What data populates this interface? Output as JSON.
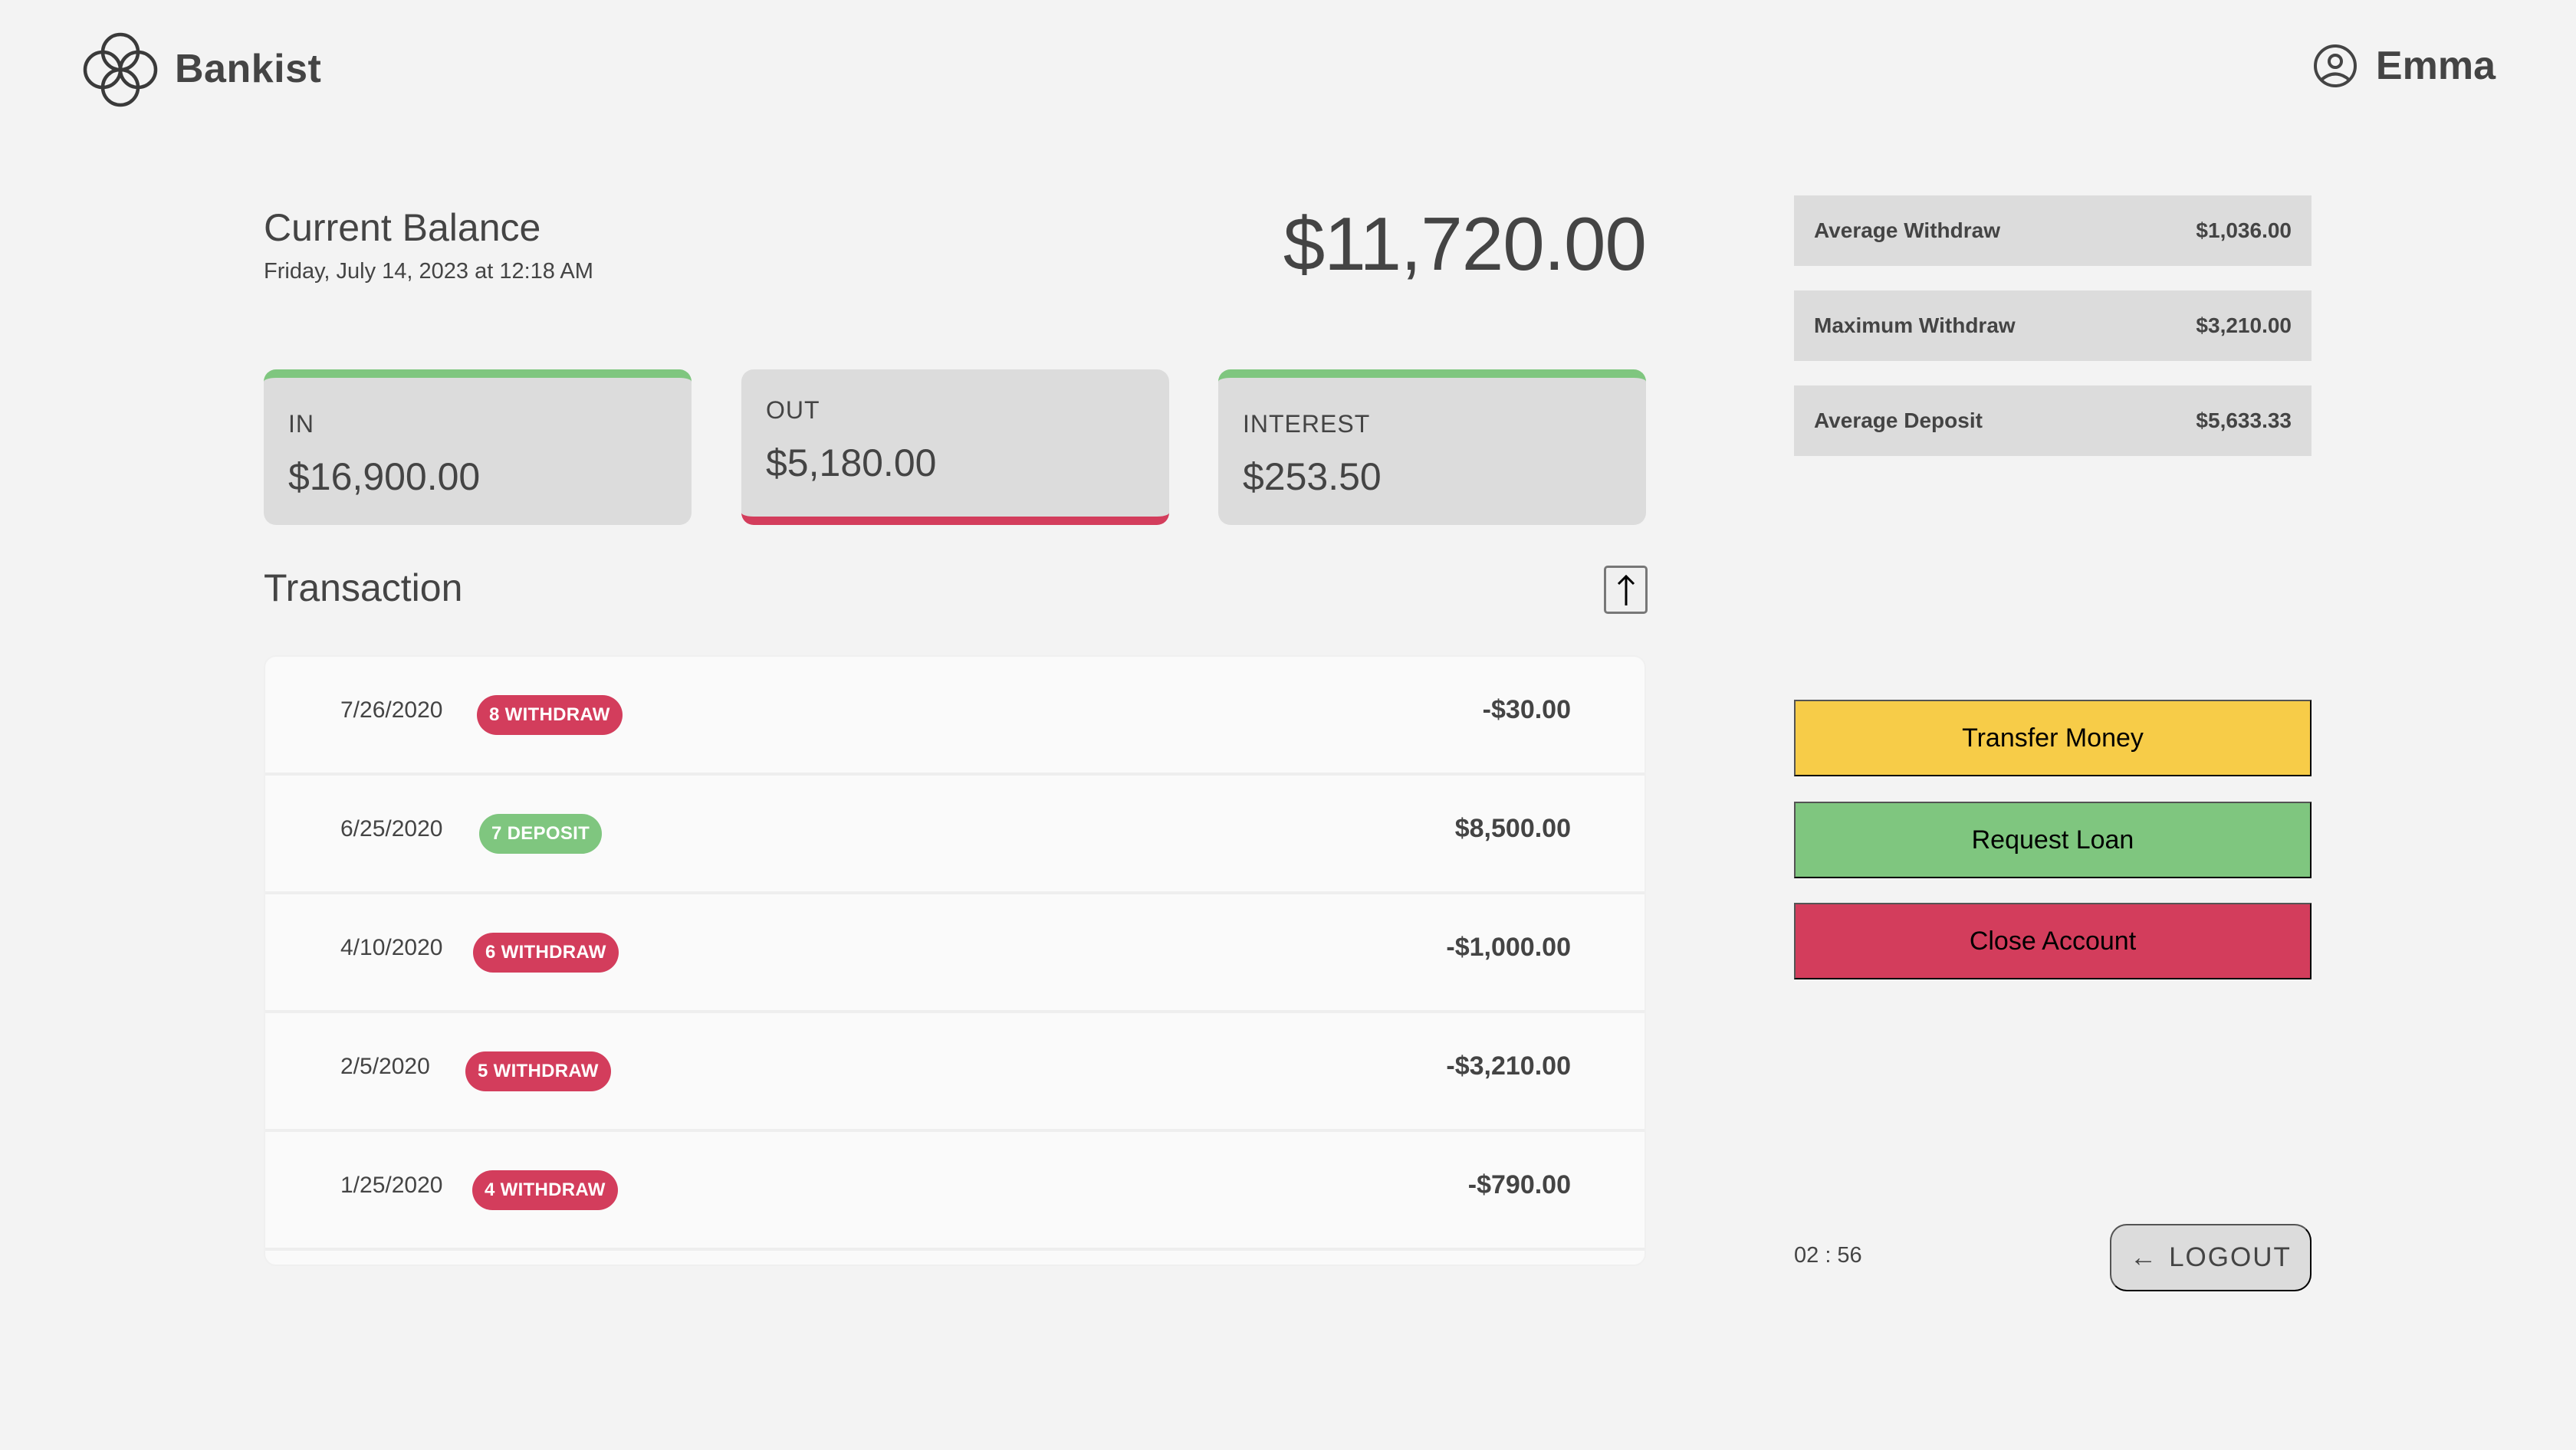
{
  "header": {
    "brand": "Bankist",
    "logo_icon": "four-circles-logo-icon",
    "user_icon": "user-circle-icon",
    "user_name": "Emma"
  },
  "balance": {
    "label": "Current Balance",
    "date": "Friday, July 14, 2023 at 12:18 AM",
    "value": "$11,720.00"
  },
  "summary": {
    "in": {
      "label": "IN",
      "value": "$16,900.00"
    },
    "out": {
      "label": "OUT",
      "value": "$5,180.00"
    },
    "interest": {
      "label": "INTEREST",
      "value": "$253.50"
    }
  },
  "transactions": {
    "title": "Transaction",
    "sort_icon": "arrow-up-icon",
    "rows": [
      {
        "date": "7/26/2020",
        "badge": "8 WITHDRAW",
        "type": "withdrawal",
        "amount": "-$30.00"
      },
      {
        "date": "6/25/2020",
        "badge": "7 DEPOSIT",
        "type": "deposit",
        "amount": "$8,500.00"
      },
      {
        "date": "4/10/2020",
        "badge": "6 WITHDRAW",
        "type": "withdrawal",
        "amount": "-$1,000.00"
      },
      {
        "date": "2/5/2020",
        "badge": "5 WITHDRAW",
        "type": "withdrawal",
        "amount": "-$3,210.00"
      },
      {
        "date": "1/25/2020",
        "badge": "4 WITHDRAW",
        "type": "withdrawal",
        "amount": "-$790.00"
      }
    ]
  },
  "stats": [
    {
      "label": "Average Withdraw",
      "value": "$1,036.00"
    },
    {
      "label": "Maximum Withdraw",
      "value": "$3,210.00"
    },
    {
      "label": "Average Deposit",
      "value": "$5,633.33"
    }
  ],
  "actions": {
    "transfer": "Transfer Money",
    "loan": "Request Loan",
    "close": "Close Account"
  },
  "footer": {
    "timer": "02 : 56",
    "logout_arrow": "←",
    "logout_label": "LOGOUT"
  },
  "colors": {
    "background": "#f3f3f3",
    "card": "#dcdcdc",
    "green": "#7fc67f",
    "red": "#d33d5c",
    "yellow": "#f7cc48",
    "text": "#444444"
  }
}
